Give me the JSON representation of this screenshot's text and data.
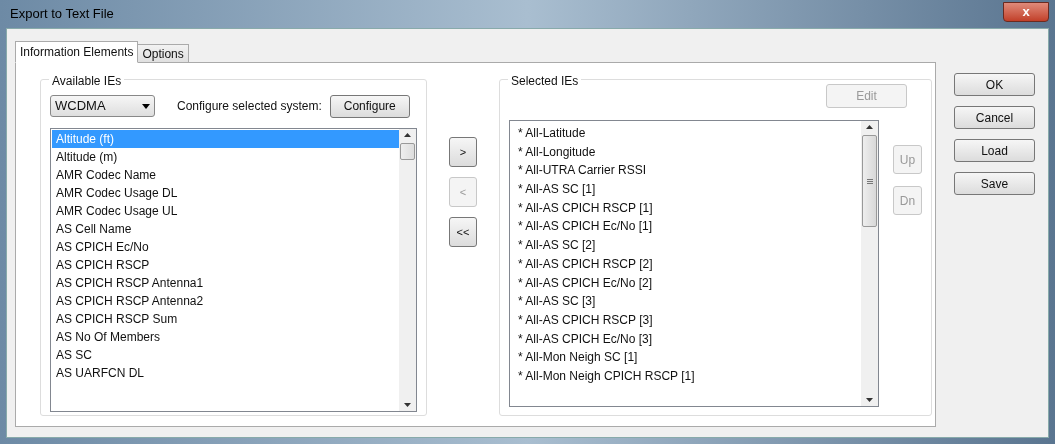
{
  "window": {
    "title": "Export to Text File",
    "close": "x"
  },
  "tabs": [
    {
      "label": "Information Elements",
      "selected": true
    },
    {
      "label": "Options",
      "selected": false
    }
  ],
  "available": {
    "title": "Available IEs",
    "system": "WCDMA",
    "configure_label": "Configure selected system:",
    "configure_button": {
      "label": "Configure",
      "disabled": false
    },
    "items": [
      {
        "label": "Altitude (ft)",
        "selected": true
      },
      {
        "label": "Altitude (m)",
        "selected": false
      },
      {
        "label": "AMR Codec Name",
        "selected": false
      },
      {
        "label": "AMR Codec Usage DL",
        "selected": false
      },
      {
        "label": "AMR Codec Usage UL",
        "selected": false
      },
      {
        "label": "AS Cell Name",
        "selected": false
      },
      {
        "label": "AS CPICH Ec/No",
        "selected": false
      },
      {
        "label": "AS CPICH RSCP",
        "selected": false
      },
      {
        "label": "AS CPICH RSCP Antenna1",
        "selected": false
      },
      {
        "label": "AS CPICH RSCP Antenna2",
        "selected": false
      },
      {
        "label": "AS CPICH RSCP Sum",
        "selected": false
      },
      {
        "label": "AS No Of Members",
        "selected": false
      },
      {
        "label": "AS SC",
        "selected": false
      },
      {
        "label": "AS UARFCN DL",
        "selected": false
      }
    ]
  },
  "move_buttons": [
    {
      "label": ">",
      "disabled": false
    },
    {
      "label": "<",
      "disabled": true
    },
    {
      "label": "<<",
      "disabled": false
    }
  ],
  "selected_ies": {
    "title": "Selected IEs",
    "edit_button": {
      "label": "Edit",
      "disabled": true
    },
    "items": [
      "* All-Latitude",
      "* All-Longitude",
      "* All-UTRA Carrier RSSI",
      "* All-AS SC [1]",
      "* All-AS CPICH RSCP [1]",
      "* All-AS CPICH Ec/No [1]",
      "* All-AS SC [2]",
      "* All-AS CPICH RSCP [2]",
      "* All-AS CPICH Ec/No [2]",
      "* All-AS SC [3]",
      "* All-AS CPICH RSCP [3]",
      "* All-AS CPICH Ec/No [3]",
      "* All-Mon Neigh SC [1]",
      "* All-Mon Neigh CPICH RSCP [1]"
    ],
    "order_buttons": [
      {
        "label": "Up",
        "disabled": true
      },
      {
        "label": "Dn",
        "disabled": true
      }
    ]
  },
  "dialog_buttons": [
    {
      "label": "OK",
      "disabled": false
    },
    {
      "label": "Cancel",
      "disabled": false
    },
    {
      "label": "Load",
      "disabled": false
    },
    {
      "label": "Save",
      "disabled": false
    }
  ]
}
